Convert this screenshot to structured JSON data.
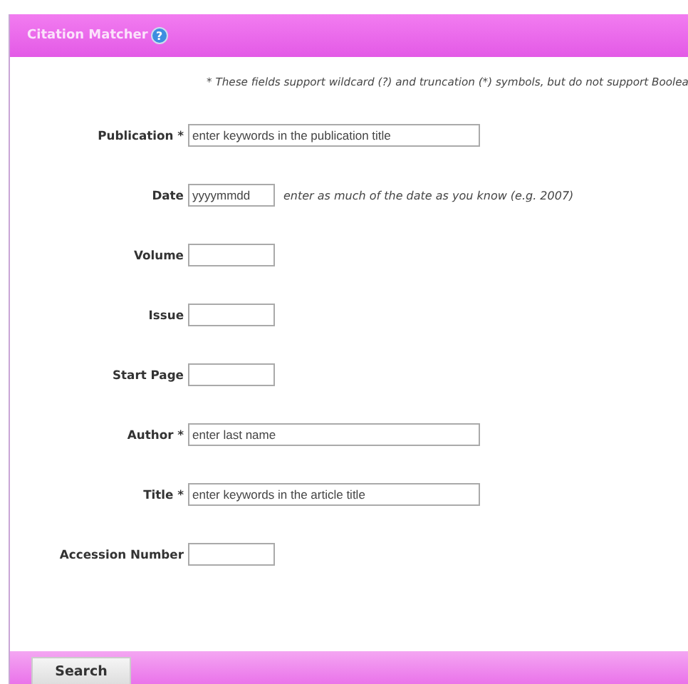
{
  "header": {
    "title": "Citation Matcher",
    "help": "?"
  },
  "note": "* These fields support wildcard (?) and truncation (*) symbols, but do not support Boolea",
  "fields": [
    {
      "label": "Publication *",
      "kind": "wide",
      "placeholder": "enter keywords in the publication title"
    },
    {
      "label": "Date",
      "kind": "short",
      "placeholder": "yyyymmdd",
      "hint": "enter as much of the date as you know (e.g. 2007)"
    },
    {
      "label": "Volume",
      "kind": "short"
    },
    {
      "label": "Issue",
      "kind": "short"
    },
    {
      "label": "Start Page",
      "kind": "short"
    },
    {
      "label": "Author *",
      "kind": "wide",
      "placeholder": "enter last name"
    },
    {
      "label": "Title *",
      "kind": "wide",
      "placeholder": "enter keywords in the article title"
    },
    {
      "label": "Accession Number",
      "kind": "short"
    }
  ],
  "button": "Search"
}
